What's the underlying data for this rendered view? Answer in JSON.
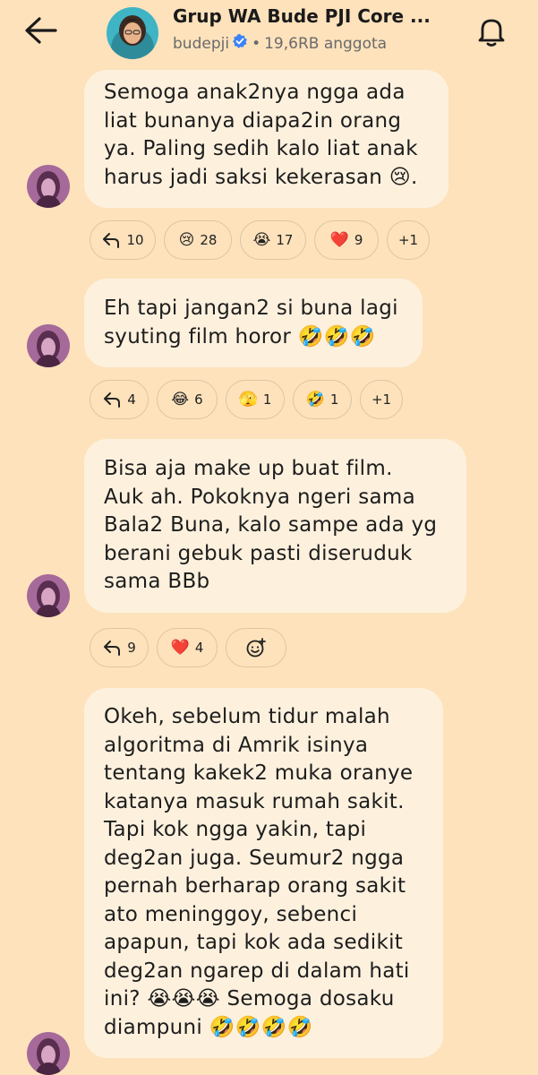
{
  "header": {
    "title": "Grup WA Bude PJI Core ...",
    "username": "budepji",
    "separator": "•",
    "members": "19,6RB anggota"
  },
  "messages": [
    {
      "lines": [
        "Semoga anak2nya ngga ada",
        "liat bunanya diapa2in orang",
        "ya. Paling sedih kalo liat anak",
        "harus jadi saksi kekerasan 😢."
      ],
      "reactions": [
        {
          "icon": "reply-icon",
          "count": "10"
        },
        {
          "icon": "😢",
          "count": "28"
        },
        {
          "icon": "😭",
          "count": "17"
        },
        {
          "icon": "❤️",
          "count": "9"
        },
        {
          "icon": "",
          "count": "+1"
        }
      ]
    },
    {
      "lines": [
        "Eh tapi jangan2 si buna lagi",
        "syuting film horor 🤣🤣🤣"
      ],
      "reactions": [
        {
          "icon": "reply-icon",
          "count": "4"
        },
        {
          "icon": "😂",
          "count": "6"
        },
        {
          "icon": "🫣",
          "count": "1"
        },
        {
          "icon": "🤣",
          "count": "1"
        },
        {
          "icon": "",
          "count": "+1"
        }
      ]
    },
    {
      "lines": [
        "Bisa aja make up buat film.",
        "Auk ah. Pokoknya ngeri sama",
        "Bala2 Buna, kalo sampe ada yg",
        "berani gebuk pasti diseruduk",
        "sama BBb"
      ],
      "reactions": [
        {
          "icon": "reply-icon",
          "count": "9"
        },
        {
          "icon": "❤️",
          "count": "4"
        },
        {
          "icon": "add-reaction-icon",
          "count": ""
        }
      ]
    },
    {
      "lines": [
        "Okeh, sebelum tidur malah",
        "algoritma di Amrik isinya",
        "tentang kakek2 muka oranye",
        "katanya masuk rumah sakit.",
        "Tapi kok ngga yakin, tapi",
        "deg2an juga. Seumur2 ngga",
        "pernah berharap orang sakit",
        "ato meninggoy, sebenci",
        "apapun, tapi kok ada sedikit",
        "deg2an ngarep di dalam hati",
        "ini? 😭😭😭 Semoga dosaku",
        "diampuni 🤣🤣🤣🤣"
      ],
      "reactions": []
    }
  ]
}
